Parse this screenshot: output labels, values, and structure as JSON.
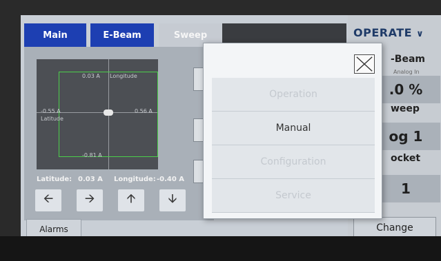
{
  "tabs": {
    "main": "Main",
    "ebeam": "E-Beam",
    "sweep": "Sweep"
  },
  "scope": {
    "top_value": "0.03 A",
    "top_name": "Longitude",
    "left_value": "-0.55 A",
    "left_name": "Latitude",
    "right_value": "0.56 A",
    "bottom_value": "-0.81 A"
  },
  "readouts": {
    "latitude_label": "Latitude:",
    "latitude_value": "0.03 A",
    "longitude_label": "Longitude:",
    "longitude_value": "-0.40 A"
  },
  "alarms_label": "Alarms",
  "right_panel": {
    "title": "OPERATE",
    "ebeam_label": "-Beam",
    "analog_label": "Analog In",
    "ebeam_value": ".0 %",
    "sweep_label": "weep",
    "sweep_value": "og 1",
    "pocket_label": "ocket",
    "pocket_value": "1",
    "change_label": "Change"
  },
  "dialog": {
    "items": [
      {
        "label": "Operation",
        "enabled": false
      },
      {
        "label": "Manual",
        "enabled": true
      },
      {
        "label": "Configuration",
        "enabled": false
      },
      {
        "label": "Service",
        "enabled": false
      }
    ]
  },
  "colors": {
    "tab_active_blue": "#1d3fb2",
    "trace_green": "#4bd04b",
    "operate_text": "#1f3b68"
  },
  "icons": {
    "left": "arrow-left-icon",
    "right": "arrow-right-icon",
    "up": "arrow-up-icon",
    "down": "arrow-down-icon",
    "close": "close-icon",
    "chevron": "chevron-down-icon"
  }
}
